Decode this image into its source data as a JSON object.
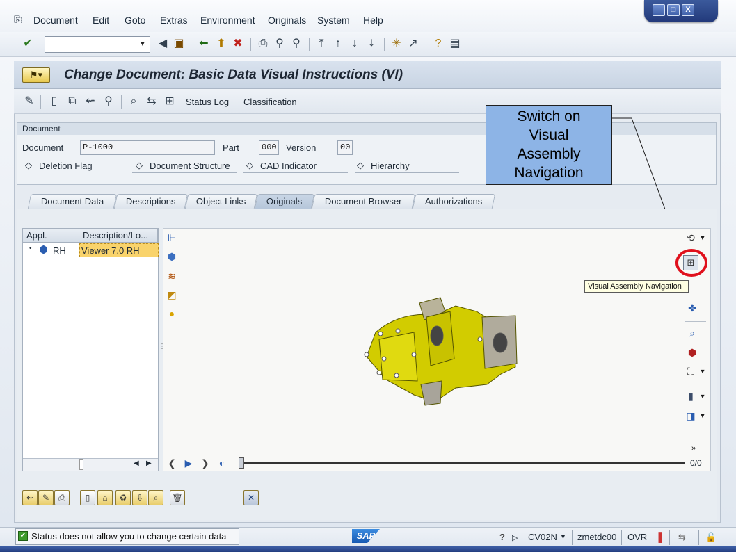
{
  "menu": {
    "items": [
      "Document",
      "Edit",
      "Goto",
      "Extras",
      "Environment",
      "Originals",
      "System",
      "Help"
    ]
  },
  "window_controls": [
    "_",
    "□",
    "X"
  ],
  "header": {
    "title": "Change Document: Basic Data Visual Instructions (VI)"
  },
  "app_toolbar": {
    "status_log": "Status Log",
    "classification": "Classification"
  },
  "document_group": {
    "heading": "Document",
    "document_label": "Document",
    "document_value": "P-1000",
    "part_label": "Part",
    "part_value": "000",
    "version_label": "Version",
    "version_value": "00",
    "deletion_flag": "Deletion Flag",
    "document_structure": "Document Structure",
    "cad_indicator": "CAD Indicator",
    "hierarchy": "Hierarchy"
  },
  "callout": {
    "line1": "Switch on",
    "line2": "Visual",
    "line3": "Assembly",
    "line4": "Navigation"
  },
  "tabs": [
    "Document Data",
    "Descriptions",
    "Object Links",
    "Originals",
    "Document Browser",
    "Authorizations"
  ],
  "active_tab": "Originals",
  "originals_tree": {
    "columns": [
      "Appl.",
      "Description/Lo..."
    ],
    "rows": [
      {
        "appl": "RH",
        "description": "Viewer 7.0 RH"
      }
    ]
  },
  "viewer": {
    "tooltip": "Visual Assembly Navigation",
    "frame_counter": "0/0"
  },
  "status_bar": {
    "message": "Status does not allow you to change certain data",
    "logo": "SAP",
    "transaction": "CV02N",
    "server": "zmetdc00",
    "mode": "OVR"
  },
  "colors": {
    "callout_fill": "#8db4e6",
    "highlight_circle": "#e0101c",
    "model_yellow": "#d8d400",
    "selected_row": "#f9d36b"
  }
}
